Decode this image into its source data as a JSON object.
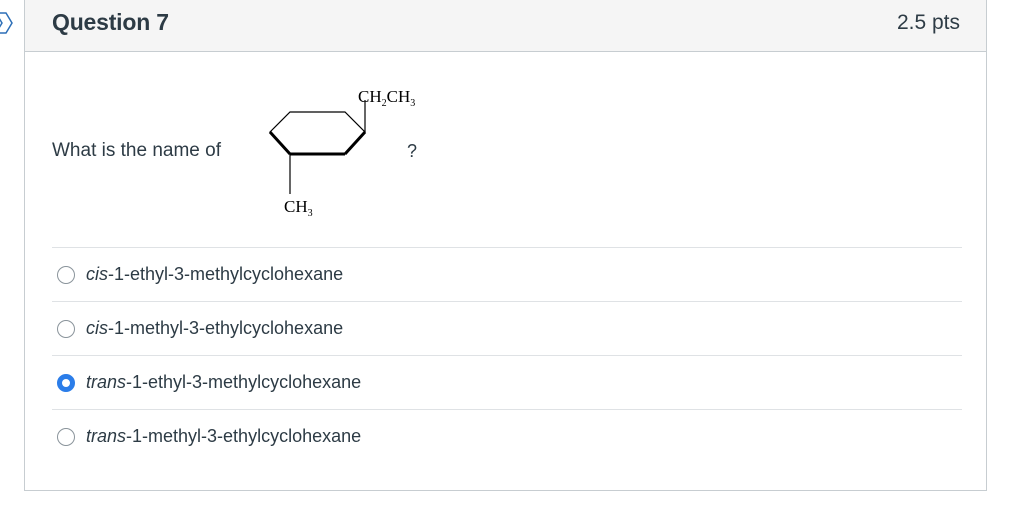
{
  "question": {
    "title": "Question 7",
    "points": "2.5 pts",
    "prompt": "What is the name of",
    "prompt_end": "?",
    "structure_labels": {
      "top_substituent": "CH2CH3",
      "bottom_substituent": "CH3"
    }
  },
  "answers": [
    {
      "prefix": "cis",
      "rest": "-1-ethyl-3-methylcyclohexane",
      "selected": false
    },
    {
      "prefix": "cis",
      "rest": "-1-methyl-3-ethylcyclohexane",
      "selected": false
    },
    {
      "prefix": "trans",
      "rest": "-1-ethyl-3-methylcyclohexane",
      "selected": true
    },
    {
      "prefix": "trans",
      "rest": "-1-methyl-3-ethylcyclohexane",
      "selected": false
    }
  ],
  "colors": {
    "accent": "#2b7de9",
    "header_bg": "#f5f5f5",
    "text": "#2d3b45",
    "border": "#c7cdd1"
  },
  "icons": {
    "flag": "question-flag-icon"
  }
}
